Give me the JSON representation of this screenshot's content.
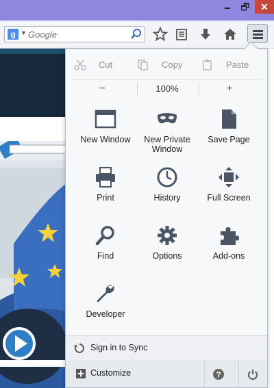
{
  "window": {
    "minimize_glyph": "🗕",
    "maximize_glyph": "🗗",
    "close_glyph": "✕"
  },
  "toolbar": {
    "search_engine_letter": "g",
    "search_placeholder": "Google",
    "icons": [
      "search-icon",
      "bookmark-star-icon",
      "reading-list-icon",
      "download-icon",
      "home-icon",
      "menu-icon"
    ]
  },
  "menu": {
    "edit": {
      "cut": "Cut",
      "copy": "Copy",
      "paste": "Paste"
    },
    "zoom": {
      "out": "−",
      "level": "100%",
      "in": "+"
    },
    "items": [
      {
        "label": "New Window",
        "icon": "window-icon"
      },
      {
        "label": "New Private Window",
        "icon": "mask-icon"
      },
      {
        "label": "Save Page",
        "icon": "page-icon"
      },
      {
        "label": "Print",
        "icon": "printer-icon"
      },
      {
        "label": "History",
        "icon": "clock-icon"
      },
      {
        "label": "Full Screen",
        "icon": "fullscreen-icon"
      },
      {
        "label": "Find",
        "icon": "magnifier-icon"
      },
      {
        "label": "Options",
        "icon": "gear-icon"
      },
      {
        "label": "Add-ons",
        "icon": "puzzle-icon"
      },
      {
        "label": "Developer",
        "icon": "wrench-icon"
      }
    ],
    "sync_label": "Sign in to Sync",
    "customize_label": "Customize",
    "help_glyph": "?"
  },
  "colors": {
    "titlebar": "#8f86e0",
    "close": "#c9463d",
    "accent_icon": "#4a5566"
  }
}
